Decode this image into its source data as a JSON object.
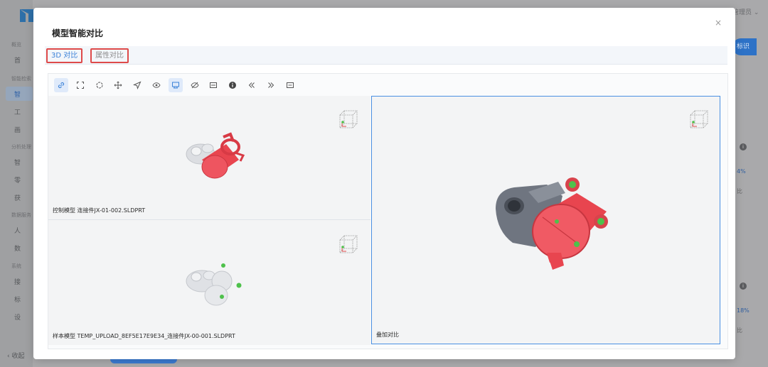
{
  "background": {
    "sidebar_sections": [
      "概览",
      "智能检索",
      "分析处理",
      "数据服务",
      "系统"
    ],
    "sidebar_items": [
      "首",
      "智",
      "工",
      "画",
      "智",
      "零",
      "获",
      "人",
      "数",
      "接",
      "标",
      "设"
    ],
    "collapse_label": "收起",
    "right_button_label": "标识",
    "user_label": "管理员",
    "percent_values": [
      "4%",
      "18%"
    ],
    "small_labels": [
      "比",
      "比"
    ]
  },
  "modal": {
    "title": "模型智能对比",
    "close_icon": "×"
  },
  "tabs": [
    {
      "label": "3D 对比",
      "active": true
    },
    {
      "label": "属性对比",
      "active": false
    }
  ],
  "toolbar": {
    "tools": [
      "link-icon",
      "fullscreen-icon",
      "rotate-icon",
      "move-icon",
      "pointer-icon",
      "eye-icon",
      "explode-icon",
      "hide-icon",
      "section-icon",
      "info-icon",
      "prev-icon",
      "next-icon",
      "layout-icon"
    ],
    "active_tools": [
      "link-icon",
      "explode-icon"
    ]
  },
  "panes": {
    "control_model": "控制模型 连接件JX-01-002.SLDPRT",
    "sample_model": "样本模型 TEMP_UPLOAD_8EF5E17E9E34_连接件JX-00-001.SLDPRT",
    "overlay": "叠加对比"
  },
  "colors": {
    "accent": "#3b82d8",
    "highlight_border": "#de4a4a",
    "model_red": "#e8454f",
    "model_gray": "#6f7580",
    "model_green": "#4ec14b"
  }
}
